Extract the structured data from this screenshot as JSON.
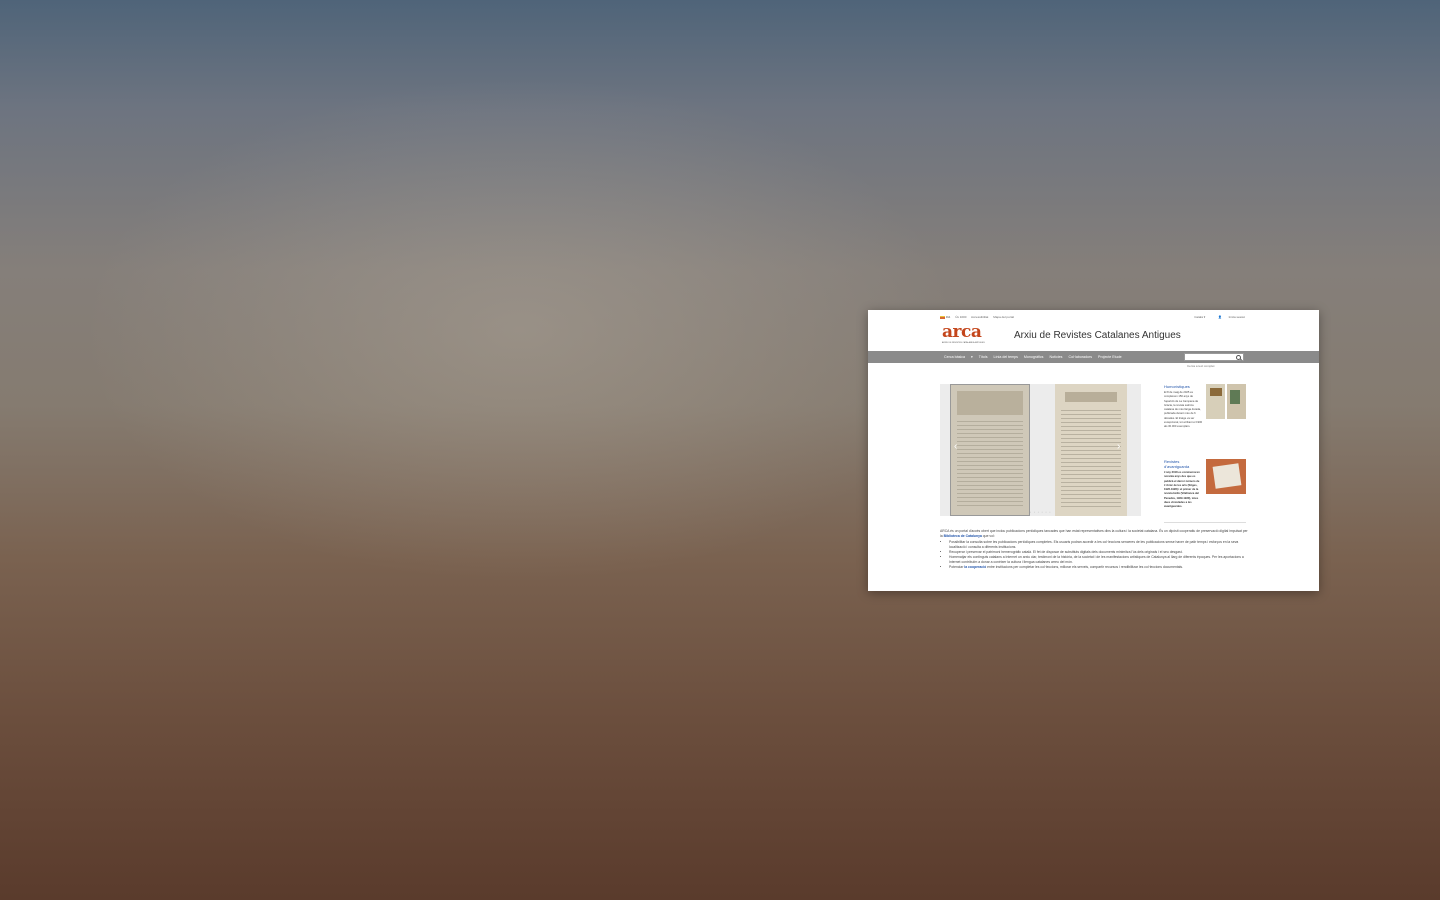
{
  "topbar": {
    "lang": "CA",
    "links": [
      "Ús 1000",
      "Accessibilitat",
      "Mapa del portal"
    ],
    "right": [
      "Català",
      "Inicia sessió"
    ]
  },
  "logo": {
    "word": "arca",
    "tagline": "ARXIU DE REVISTES CATALANES ANTIGUES"
  },
  "site_title": "Arxiu de Revistes Catalanes Antigues",
  "nav": {
    "items": [
      "Cerca bàsica",
      "Títols",
      "Línia del temps",
      "Monogràfics",
      "Notícies",
      "Col·laboradors",
      "Projecte Etude"
    ],
    "search_placeholder": "Cerca a text complet"
  },
  "carousel": {
    "prev": "‹",
    "next": "›",
    "dots": "• • • • • •"
  },
  "news": [
    {
      "title": "Humorístiques",
      "text": "El 8 de maig de 2025 es compleixen 150 anys de l'aparició de La Campana de Gràcia, la revista satírica catalana de més llarga durada, publicada durant més de 6 dècades. El tiratge va ser excepcional, tot arribant el 1900 als 30.000 exemplars."
    },
    {
      "title": "Revistes d'avantguarda",
      "text": "L'any 2018 es commemoren noranta anys des que es publicà el darrer número de L'Amic de les arts (Sitges, 1926-1928) i el primer de la revista Hèlix (Vilafranca del Penedès, 1929-1930), totes dues vinculades a les avantguardes."
    }
  ],
  "intro": {
    "p_a": "ARCA és un portal d'accés obert que inclou publicacions periòdiques tancades que han estat representatives dins la cultura i la societat catalana. És un dipòsit cooperatiu de preservació digital impulsat per la",
    "p_link": "Biblioteca de Catalunya",
    "p_b": "que vol:",
    "bullets": [
      "Possibilitar la consulta sobre les publicacions periòdiques completes. Els usuaris podran accedir a les col·leccions senceres de les publicacions sense haver de patir temps i esforços en la seva localització i consulta a diferents institucions.",
      "Recuperar i preservar el patrimoni hemerogràfic català. El fet de disposar de substituts digitals dels documents minimitza l'ús dels originals i el seu desgast.",
      "Homenatjar els continguts catalans a Internet un arxiu clar, testimoni de la història, de la societat i de les manifestacions artístiques de Catalunya al llarg de diferents èpoques. Per les aportacions a Internet contribuïm a donar a conèixer la cultura i llengua catalanes arreu del món."
    ],
    "last_a": "Potenciar",
    "last_link": "la cooperació",
    "last_b": "entre institucions per completar les col·leccions, millorar els serveis, compartir recursos i rendibilitzar les col·leccions documentals."
  }
}
